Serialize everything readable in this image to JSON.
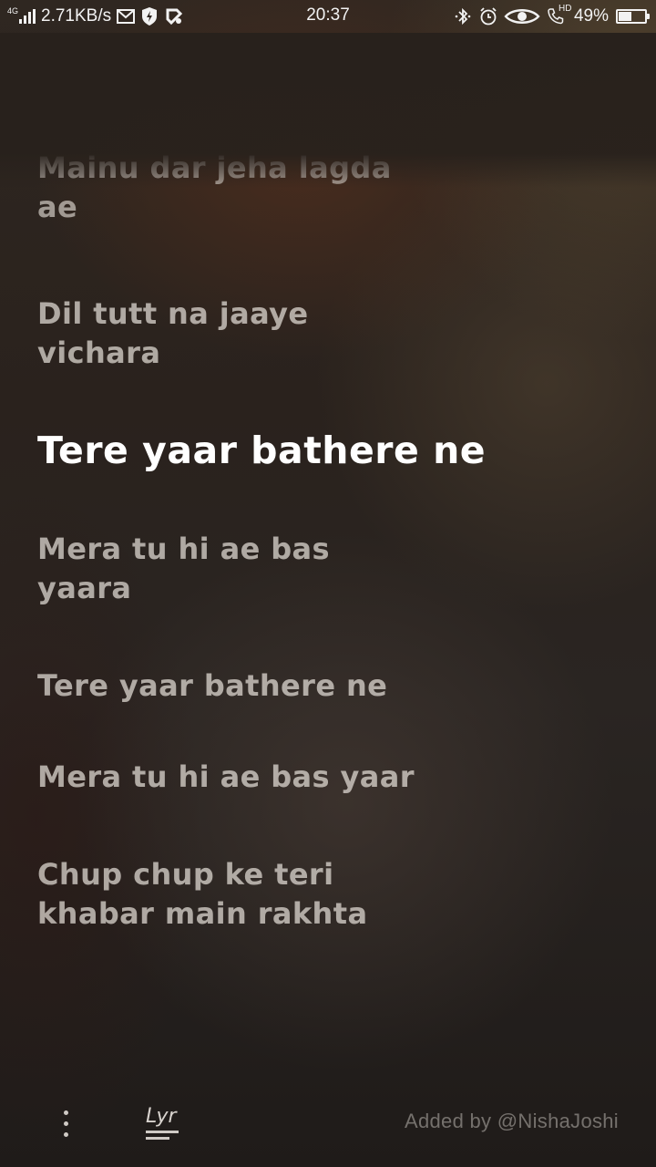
{
  "status_bar": {
    "network_type": "4G",
    "speed": "2.71KB/s",
    "time": "20:37",
    "hd_label": "HD",
    "battery_percent": "49%",
    "battery_level": 0.49,
    "icons": [
      "signal-icon",
      "gmail-icon",
      "shield-bolt-icon",
      "app-icon",
      "bluetooth-icon",
      "alarm-icon",
      "eye-icon",
      "hd-call-icon",
      "battery-icon"
    ]
  },
  "lyrics": {
    "lines": [
      "Mainu dar jeha lagda\nae",
      "Dil tutt na jaaye\nvichara",
      "Tere yaar bathere ne",
      "Mera tu hi ae bas\nyaara",
      "Tere yaar bathere ne",
      "Mera tu hi ae bas yaar",
      "Chup chup ke teri\nkhabar main rakhta"
    ],
    "active_index": 2
  },
  "bottom_bar": {
    "logo_text": "Lyr",
    "added_by": "Added by @NishaJoshi"
  }
}
